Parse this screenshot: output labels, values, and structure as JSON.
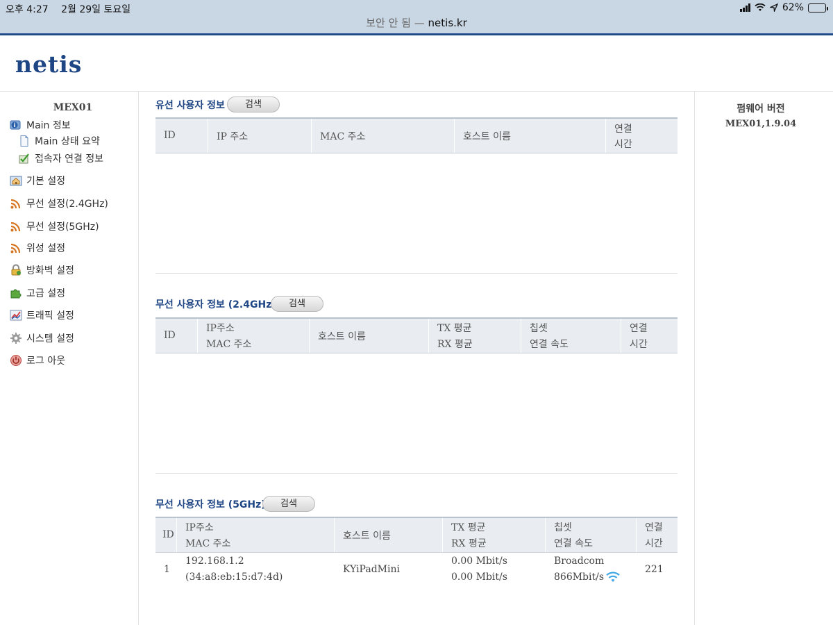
{
  "status_bar": {
    "time": "오후 4:27",
    "date": "2월 29일 토요일",
    "battery": "62%",
    "battery_level": 0.62,
    "url_prefix": "보안 안 됨 —",
    "url_host": "netis.kr"
  },
  "logo": "netis",
  "sidebar": {
    "device": "MEX01",
    "items": [
      {
        "label": "Main 정보",
        "icon": "info-icon"
      },
      {
        "label": "Main 상태 요약",
        "icon": "document-icon"
      },
      {
        "label": "접속자 연결 정보",
        "icon": "checklist-icon"
      },
      {
        "label": "기본 설정",
        "icon": "home-icon"
      },
      {
        "label": "무선 설정(2.4GHz)",
        "icon": "rss-icon"
      },
      {
        "label": "무선 설정(5GHz)",
        "icon": "rss-icon"
      },
      {
        "label": "위성 설정",
        "icon": "rss-icon"
      },
      {
        "label": "방화벽 설정",
        "icon": "lock-icon"
      },
      {
        "label": "고급 설정",
        "icon": "puzzle-icon"
      },
      {
        "label": "트래픽 설정",
        "icon": "chart-icon"
      },
      {
        "label": "시스템 설정",
        "icon": "gear-icon"
      },
      {
        "label": "로그 아웃",
        "icon": "power-icon"
      }
    ]
  },
  "firmware": {
    "title": "펌웨어 버전",
    "version": "MEX01,1.9.04"
  },
  "wired": {
    "title": "유선 사용자 정보",
    "search": "검색",
    "columns": [
      "ID",
      "IP 주소",
      "MAC 주소",
      "호스트 이름",
      "연결",
      "시간"
    ]
  },
  "wireless24": {
    "title": "무선 사용자 정보 (2.4GHz)",
    "search": "검색",
    "columns": [
      "ID",
      "IP주소",
      "MAC 주소",
      "호스트 이름",
      "TX 평균",
      "RX 평균",
      "칩셋",
      "연결 속도",
      "연결",
      "시간"
    ]
  },
  "wireless5": {
    "title": "무선 사용자 정보 (5GHz)",
    "search": "검색",
    "columns": [
      "ID",
      "IP주소",
      "MAC 주소",
      "호스트 이름",
      "TX 평균",
      "RX 평균",
      "칩셋",
      "연결 속도",
      "연결",
      "시간"
    ],
    "rows": [
      {
        "id": "1",
        "ip": "192.168.1.2",
        "mac": "(34:a8:eb:15:d7:4d)",
        "host": "KYiPadMini",
        "tx": "0.00 Mbit/s",
        "rx": "0.00 Mbit/s",
        "chipset": "Broadcom",
        "speed": "866Mbit/s",
        "time": "221"
      }
    ]
  }
}
